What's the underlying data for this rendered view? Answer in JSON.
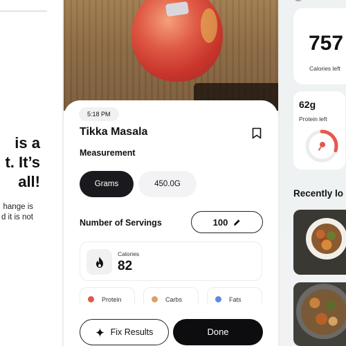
{
  "left_panel": {
    "headline_lines": [
      "is a",
      "t. It’s",
      "all!"
    ],
    "body_lines": [
      "hange is",
      "d it is not"
    ]
  },
  "meal": {
    "time": "5:18 PM",
    "title": "Tikka Masala",
    "measurement_label": "Measurement",
    "unit_selected": "Grams",
    "unit_value": "450.0G",
    "servings_label": "Number of Servings",
    "servings_value": "100",
    "calories_label": "Calories",
    "calories_value": "82",
    "macros": [
      {
        "label": "Protein",
        "color": "#e0574f"
      },
      {
        "label": "Carbs",
        "color": "#e0a060"
      },
      {
        "label": "Fats",
        "color": "#5b8be0"
      }
    ],
    "fix_button": "Fix Results",
    "done_button": "Done"
  },
  "dashboard": {
    "calories_value": "757",
    "calories_label": "Calories left",
    "protein_value": "62g",
    "protein_label": "Protein left",
    "protein_progress": 0.3,
    "recent_title": "Recently lo"
  },
  "colors": {
    "accent_dark": "#0d0d0f",
    "protein_ring": "#e8574e"
  }
}
